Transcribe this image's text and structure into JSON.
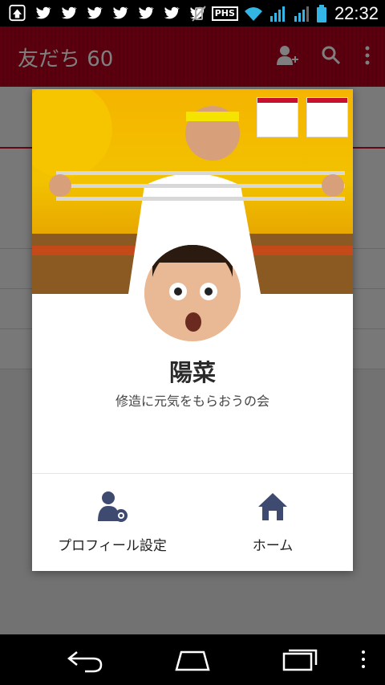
{
  "status_bar": {
    "phs_label": "PHS",
    "time": "22:32"
  },
  "app_bar": {
    "title": "友だち 60"
  },
  "profile": {
    "name": "陽菜",
    "status_message": "修造に元気をもらおうの会"
  },
  "actions": {
    "profile_settings_label": "プロフィール設定",
    "home_label": "ホーム"
  },
  "colors": {
    "accent": "#b8001f",
    "icon_navy": "#3f4a70"
  }
}
